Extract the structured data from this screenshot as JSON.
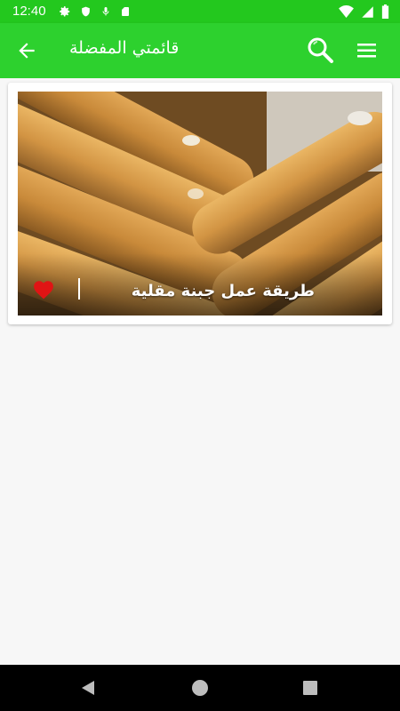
{
  "status_bar": {
    "time": "12:40",
    "left_icons": [
      "gear-icon",
      "shield-icon",
      "mic-icon",
      "sd-card-icon"
    ],
    "right_icons": [
      "wifi-icon",
      "signal-icon",
      "battery-icon"
    ]
  },
  "app_bar": {
    "title": "قائمتي المفضلة",
    "background_color": "#2dd12e",
    "back_icon": "arrow-back-icon",
    "search_icon": "search-icon",
    "menu_icon": "menu-icon"
  },
  "favorites": [
    {
      "title": "طريقة عمل جبنة مقلية",
      "image": "fried-cheese-sticks-photo",
      "favorited": true,
      "heart_color": "#e01414"
    }
  ],
  "nav_bar": {
    "buttons": [
      "nav-back-icon",
      "nav-home-icon",
      "nav-recents-icon"
    ]
  }
}
